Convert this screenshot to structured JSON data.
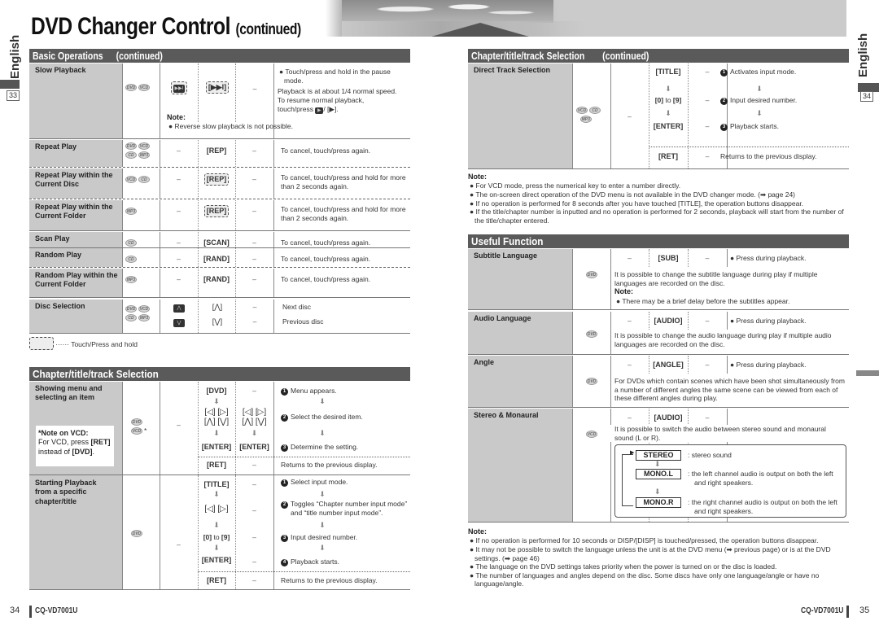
{
  "header": {
    "title": "DVD Changer Control",
    "title_suffix": "(continued)"
  },
  "side": {
    "left_lang": "English",
    "left_page": "33",
    "right_lang": "English",
    "right_page": "34"
  },
  "basic_ops": {
    "heading": "Basic Operations",
    "heading_suffix": "(continued)",
    "slow_playback": {
      "label": "Slow Playback",
      "discs": [
        "DVD",
        "VCD"
      ],
      "touch_key": "▶▶I",
      "press_key": "[▶▶I]",
      "remote": "–",
      "desc_bullet": "Touch/press and hold in the pause mode.",
      "desc_1": "Playback is at about 1/4 normal speed.",
      "desc_2": "To resume normal playback,",
      "desc_3": "touch/press",
      "desc_3b": "/ [▶].",
      "note_title": "Note:",
      "note": "Reverse slow playback is not possible."
    },
    "rows": [
      {
        "label": "Repeat Play",
        "discs": [
          "DVD",
          "VCD",
          "CD",
          "MP3"
        ],
        "touch": "–",
        "key": "[REP]",
        "remote": "–",
        "desc": "To cancel, touch/press again."
      },
      {
        "label": "Repeat Play within the Current Disc",
        "discs": [
          "VCD",
          "CD"
        ],
        "touch": "–",
        "key": "[REP]",
        "remote": "–",
        "desc": "To cancel, touch/press and hold for more than 2 seconds again."
      },
      {
        "label": "Repeat Play within the Current Folder",
        "discs": [
          "MP3"
        ],
        "touch": "–",
        "key": "[REP]",
        "remote": "–",
        "desc": "To cancel, touch/press and hold for more than 2 seconds again."
      },
      {
        "label": "Scan Play",
        "discs": [
          "CD"
        ],
        "touch": "–",
        "key": "[SCAN]",
        "remote": "–",
        "desc": "To cancel, touch/press again."
      },
      {
        "label": "Random Play",
        "discs": [
          "CD"
        ],
        "touch": "–",
        "key": "[RAND]",
        "remote": "–",
        "desc": "To cancel, touch/press again."
      },
      {
        "label": "Random Play within the Current Folder",
        "discs": [
          "MP3"
        ],
        "touch": "–",
        "key": "[RAND]",
        "remote": "–",
        "desc": "To cancel, touch/press again."
      }
    ],
    "disc_selection": {
      "label": "Disc Selection",
      "discs": [
        "DVD",
        "VCD",
        "CD",
        "MP3"
      ],
      "up_key": "[⋀]",
      "down_key": "[⋁]",
      "remote": "–",
      "up_desc": "Next disc",
      "down_desc": "Previous disc"
    },
    "legend": "······ Touch/Press and hold"
  },
  "chapter_sel": {
    "heading": "Chapter/title/track Selection",
    "menu": {
      "label": "Showing menu and selecting an item",
      "note_title": "*Note on VCD:",
      "note_line1": "For VCD, press",
      "note_key1": "[RET]",
      "note_line2": "instead of",
      "note_key2": "[DVD]",
      "note_end": ".",
      "discs": [
        "DVD",
        "VCD"
      ],
      "asterisk": "*",
      "touch": "–",
      "k1": "[DVD]",
      "r1": "–",
      "d1": "Menu appears.",
      "k2a": "[◁] [▷]",
      "k2b": "[⋀] [⋁]",
      "r2a": "[◁] [▷]",
      "r2b": "[⋀] [⋁]",
      "d2": "Select the desired item.",
      "k3": "[ENTER]",
      "r3": "[ENTER]",
      "d3": "Determine the setting.",
      "k4": "[RET]",
      "r4": "–",
      "d4": "Returns to the previous display."
    },
    "start": {
      "label": "Starting Playback from a specific chapter/title",
      "discs": [
        "DVD"
      ],
      "touch": "–",
      "k1": "[TITLE]",
      "r1": "–",
      "d1": "Select input mode.",
      "k2": "[◁] [▷]",
      "r2": "–",
      "d2": "Toggles “Chapter number input mode” and “title number input mode”.",
      "k3a": "[0]",
      "k3b": "to",
      "k3c": "[9]",
      "r3": "–",
      "d3": "Input desired number.",
      "k4": "[ENTER]",
      "r4": "–",
      "d4": "Playback starts.",
      "k5": "[RET]",
      "r5": "–",
      "d5": "Returns to the previous display."
    }
  },
  "chapter_cont": {
    "heading": "Chapter/title/track Selection",
    "heading_suffix": "(continued)",
    "direct": {
      "label": "Direct Track Selection",
      "discs": [
        "VCD",
        "CD",
        "MP3"
      ],
      "touch": "–",
      "k1": "[TITLE]",
      "r1": "–",
      "d1": "Activates input mode.",
      "k2a": "[0]",
      "k2b": "to",
      "k2c": "[9]",
      "r2": "–",
      "d2": "Input desired number.",
      "k3": "[ENTER]",
      "r3": "–",
      "d3": "Playback starts.",
      "k4": "[RET]",
      "r4": "–",
      "d4": "Returns to the previous display."
    },
    "note_title": "Note:",
    "notes": [
      "For VCD mode, press the numerical key to enter a number directly.",
      "The on-screen direct operation of the DVD menu is not available in the DVD changer mode. (➡ page 24)",
      "If no operation is performed for 8 seconds after you have touched [TITLE], the operation buttons disappear.",
      "If the title/chapter number is inputted and no operation is performed for 2 seconds, playback will start from the number of the title/chapter entered."
    ]
  },
  "useful": {
    "heading": "Useful Function",
    "subtitle": {
      "label": "Subtitle Language",
      "disc": "DVD",
      "touch": "–",
      "key": "[SUB]",
      "remote": "–",
      "bullet": "Press during playback.",
      "desc": "It is possible to change the subtitle language during play if multiple languages are recorded on the disc.",
      "note_title": "Note:",
      "note": "There may be a brief delay before the subtitles appear."
    },
    "audio": {
      "label": "Audio Language",
      "disc": "DVD",
      "touch": "–",
      "key": "[AUDIO]",
      "remote": "–",
      "bullet": "Press during playback.",
      "desc": "It is possible to change the audio language during play if multiple audio languages are recorded on the disc."
    },
    "angle": {
      "label": "Angle",
      "disc": "DVD",
      "touch": "–",
      "key": "[ANGLE]",
      "remote": "–",
      "bullet": "Press during playback.",
      "desc": "For DVDs which contain scenes which have been shot simultaneously from a number of different angles the same scene can be viewed from each of these different angles during play."
    },
    "stereo": {
      "label": "Stereo & Monaural",
      "disc": "VCD",
      "touch": "–",
      "key": "[AUDIO]",
      "remote": "–",
      "desc": "It is possible to switch the audio between stereo sound and monaural sound (L or R).",
      "modes": [
        {
          "name": "STEREO",
          "desc": ": stereo sound"
        },
        {
          "name": "MONO.L",
          "desc": ": the left channel audio is output on both the left and right speakers."
        },
        {
          "name": "MONO.R",
          "desc": ": the right channel audio is output on both the left and right speakers."
        }
      ]
    },
    "note_title": "Note:",
    "notes": [
      "If no operation is performed for 10 seconds or DISP/[DISP] is touched/pressed, the operation buttons disappear.",
      "It may not be possible to switch the language unless the unit is at the DVD menu (➡ previous page) or is at the DVD settings. (➡ page 46)",
      "The language on the DVD settings takes priority when the power is turned on or the disc is loaded.",
      "The number of languages and angles depend on the disc. Some discs have only one language/angle or have no language/angle."
    ]
  },
  "footer": {
    "left_page": "34",
    "left_model": "CQ-VD7001U",
    "right_model": "CQ-VD7001U",
    "right_page": "35"
  }
}
